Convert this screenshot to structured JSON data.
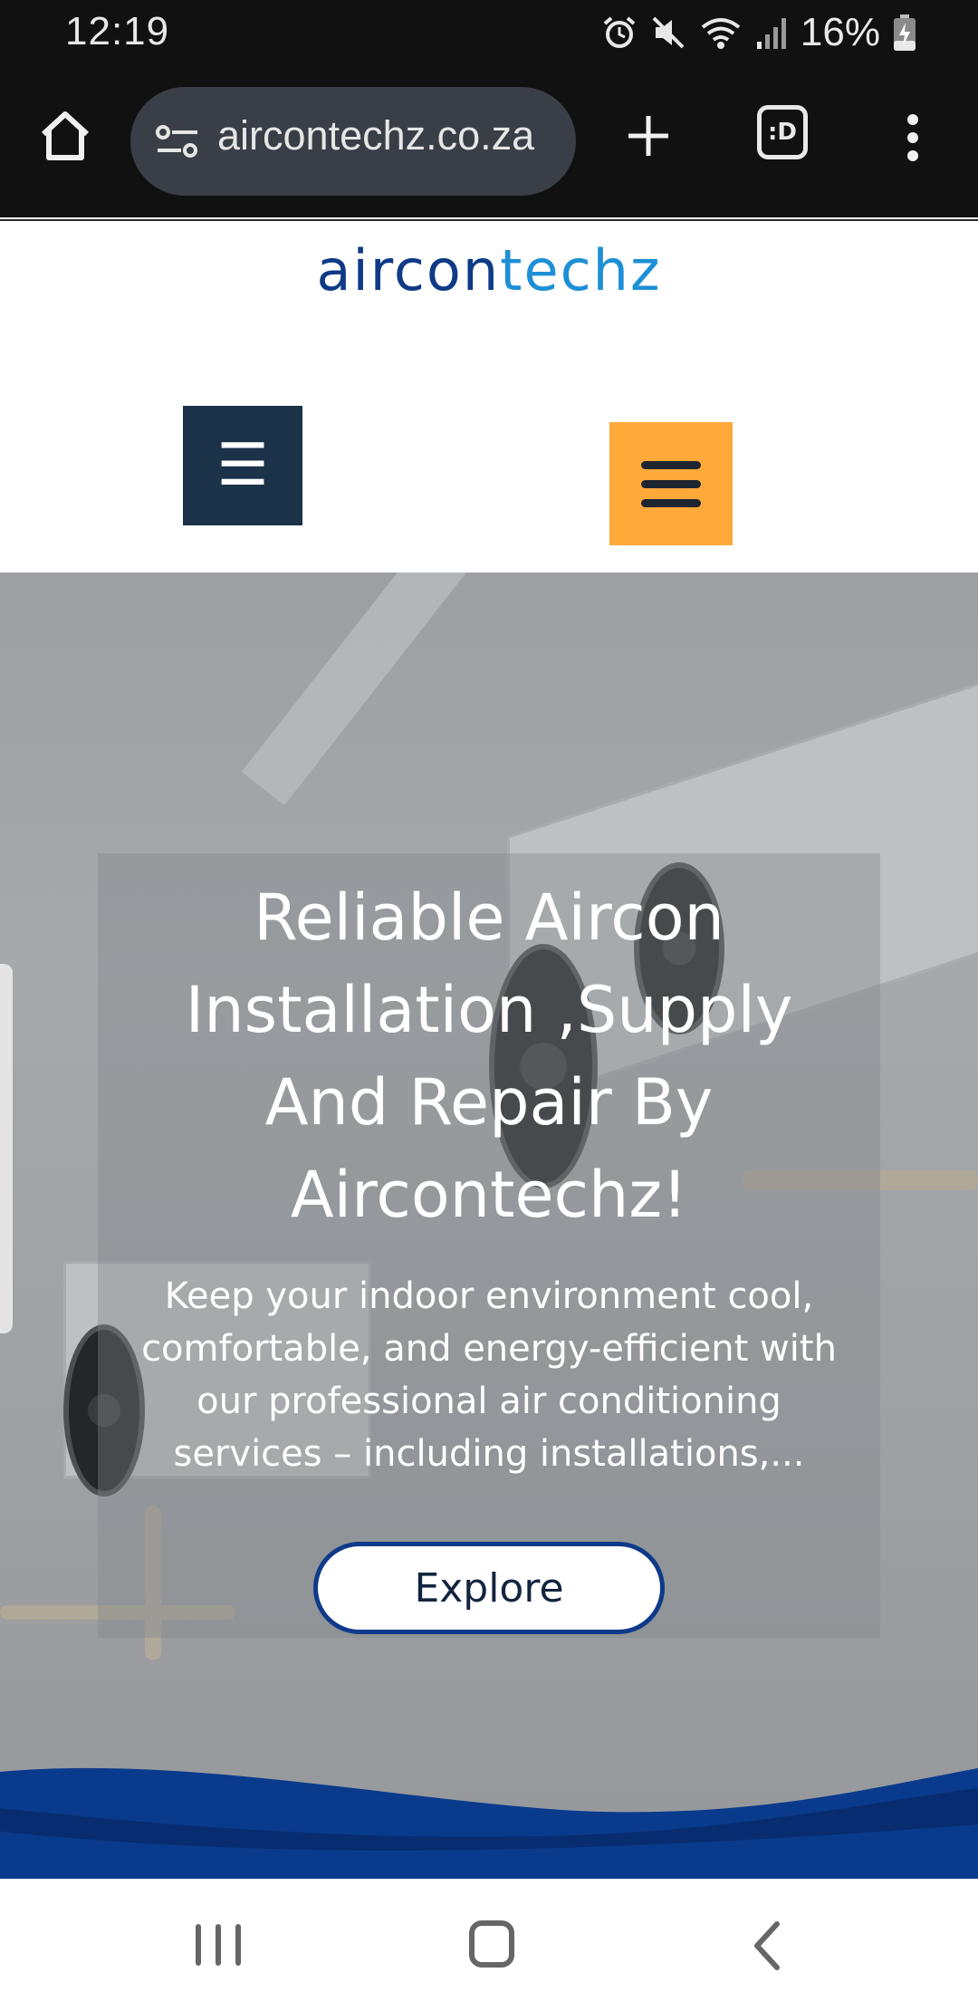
{
  "status_bar": {
    "time": "12:19",
    "battery_text": "16%",
    "icons": [
      "alarm-icon",
      "mute-icon",
      "wifi-icon",
      "signal-icon",
      "battery-charging-icon"
    ]
  },
  "browser": {
    "url": "aircontechz.co.za",
    "tabs_label": ":D",
    "icons": [
      "home-icon",
      "site-settings-icon",
      "new-tab-icon",
      "tabs-icon",
      "more-menu-icon"
    ]
  },
  "site": {
    "logo_part1": "aircon",
    "logo_part2": "techz",
    "nav_toggle_glyph": "☰",
    "colors": {
      "logo_dark": "#0e3a86",
      "logo_light": "#1d8fd6",
      "toggle_dark": "#1c3249",
      "toggle_orange": "#ffa93b",
      "wave": "#0a3a8c"
    }
  },
  "hero": {
    "title_line1": "Reliable Aircon",
    "title_line2": "Installation ,Supply",
    "title_line3": "And Repair By",
    "title_line4": "Aircontechz!",
    "desc_line1": "Keep your indoor environment cool,",
    "desc_line2": "comfortable, and energy-efficient with",
    "desc_line3": "our professional air conditioning",
    "desc_line4": "services – including installations,...",
    "button_label": "Explore"
  },
  "android_nav": {
    "icons": [
      "recent-apps-icon",
      "home-circle-icon",
      "back-icon"
    ]
  }
}
